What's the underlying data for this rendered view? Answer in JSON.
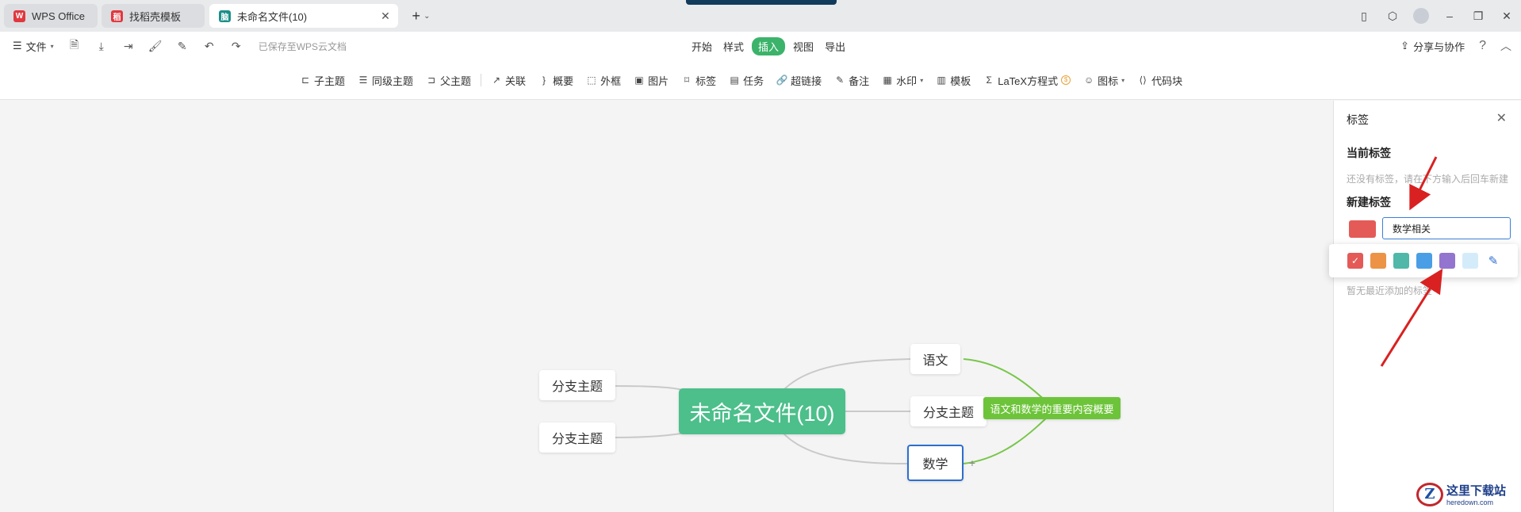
{
  "tabs": {
    "wps": "WPS Office",
    "daoke": "找稻壳模板",
    "doc": "未命名文件(10)"
  },
  "toolbar": {
    "file_label": "文件",
    "saved_status": "已保存至WPS云文档",
    "menu_tabs": [
      "开始",
      "样式",
      "插入",
      "视图",
      "导出"
    ],
    "active_tab": "插入",
    "share_label": "分享与协作"
  },
  "ribbon": {
    "items": [
      "子主题",
      "同级主题",
      "父主题",
      "关联",
      "概要",
      "外框",
      "图片",
      "标签",
      "任务",
      "超链接",
      "备注",
      "水印",
      "模板",
      "LaTeX方程式",
      "图标",
      "代码块"
    ]
  },
  "mindmap": {
    "center": "未命名文件(10)",
    "left_top": "分支主题",
    "left_bottom": "分支主题",
    "right_1": "语文",
    "right_2": "分支主题",
    "right_3": "数学",
    "summary": "语文和数学的重要内容概要"
  },
  "panel": {
    "title": "标签",
    "current_title": "当前标签",
    "current_hint": "还没有标签，请在下方输入后回车新建",
    "new_title": "新建标签",
    "input_value": "数学相关",
    "recent_hint": "暂无最近添加的标签",
    "selected_color": "#e45a57",
    "palette": [
      "#e45a57",
      "#ec9346",
      "#4fb8a8",
      "#4a9ee6",
      "#9374cf",
      "#d4ecfa"
    ]
  },
  "watermark": {
    "cn": "这里下载站",
    "en": "heredown.com"
  }
}
